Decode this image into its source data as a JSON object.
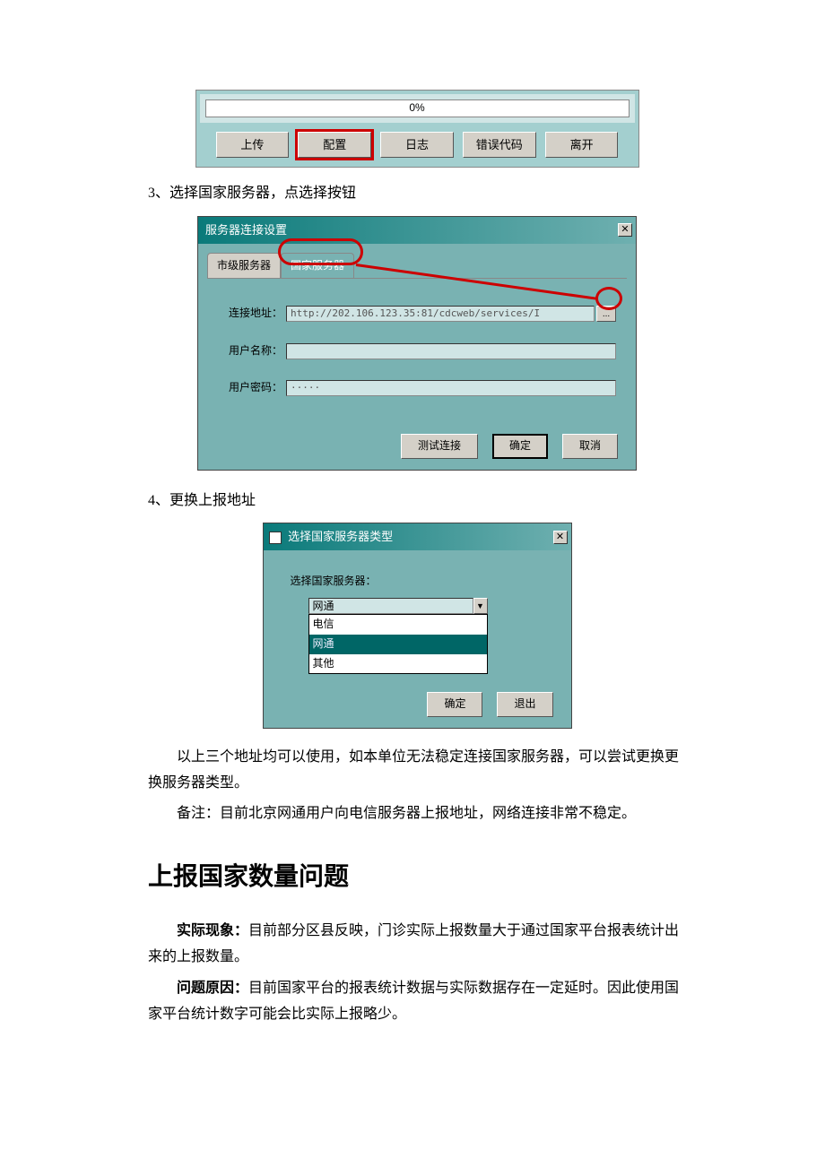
{
  "toolbar": {
    "progress": "0%",
    "buttons": {
      "upload": "上传",
      "config": "配置",
      "log": "日志",
      "errcode": "错误代码",
      "leave": "离开"
    }
  },
  "step3": "3、选择国家服务器，点选择按钮",
  "dlg1": {
    "title": "服务器连接设置",
    "tab_city": "市级服务器",
    "tab_national": "国家服务器",
    "lbl_addr": "连接地址：",
    "val_addr": "http://202.106.123.35:81/cdcweb/services/I",
    "browse": "...",
    "lbl_user": "用户名称：",
    "val_user": "",
    "lbl_pwd": "用户密码：",
    "val_pwd": "·····",
    "btn_test": "测试连接",
    "btn_ok": "确定",
    "btn_cancel": "取消"
  },
  "step4": "4、更换上报地址",
  "dlg2": {
    "title": "选择国家服务器类型",
    "label": "选择国家服务器：",
    "selected": "网通",
    "opt_tel": "电信",
    "opt_net": "网通",
    "opt_other": "其他",
    "btn_ok": "确定",
    "btn_exit": "退出"
  },
  "para_try": "以上三个地址均可以使用，如本单位无法稳定连接国家服务器，可以尝试更换更换服务器类型。",
  "para_note": "备注：目前北京网通用户向电信服务器上报地址，网络连接非常不稳定。",
  "heading": "上报国家数量问题",
  "phenom_label": "实际现象：",
  "phenom_text": "目前部分区县反映，门诊实际上报数量大于通过国家平台报表统计出来的上报数量。",
  "cause_label": "问题原因：",
  "cause_text": "目前国家平台的报表统计数据与实际数据存在一定延时。因此使用国家平台统计数字可能会比实际上报略少。"
}
